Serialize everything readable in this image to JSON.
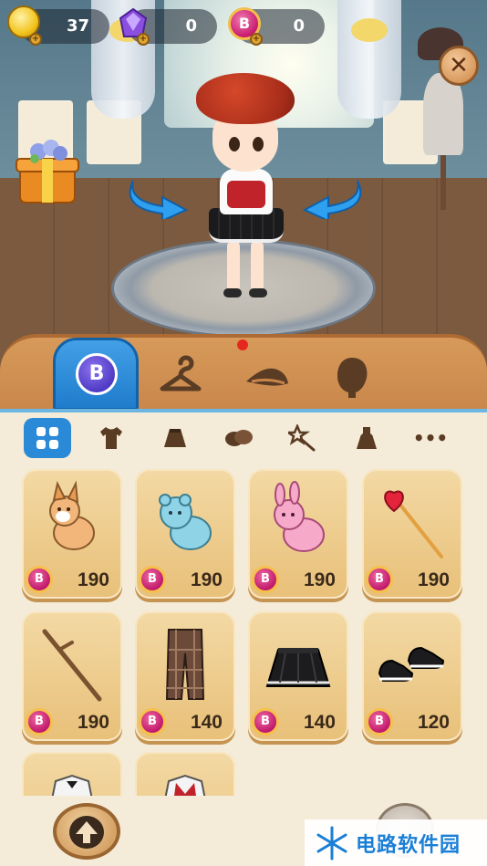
{
  "currencies": {
    "coins": {
      "value": "37",
      "icon": "gold-coin-icon"
    },
    "gems": {
      "value": "0",
      "icon": "purple-gem-icon"
    },
    "b_coins": {
      "value": "0",
      "icon": "b-coin-icon"
    }
  },
  "b_symbol": "B",
  "close_glyph": "✕",
  "tabs": [
    {
      "name": "b-shop-tab",
      "icon": "b-badge-icon",
      "active": true
    },
    {
      "name": "clothes-tab",
      "icon": "hanger-icon",
      "active": false
    },
    {
      "name": "hat-tab",
      "icon": "hat-icon",
      "active": false,
      "notification": true
    },
    {
      "name": "hair-tab",
      "icon": "head-silhouette-icon",
      "active": false
    }
  ],
  "subtabs": [
    {
      "name": "all",
      "icon": "grid-icon",
      "active": true
    },
    {
      "name": "tops",
      "icon": "tshirt-icon"
    },
    {
      "name": "bottoms",
      "icon": "skirt-icon"
    },
    {
      "name": "shoes",
      "icon": "shoes-icon"
    },
    {
      "name": "accessories",
      "icon": "wand-icon"
    },
    {
      "name": "dresses",
      "icon": "dress-icon"
    },
    {
      "name": "more",
      "icon": "more-dots-icon",
      "glyph": "•••"
    }
  ],
  "items": [
    {
      "name": "fox-plush",
      "price": "190"
    },
    {
      "name": "blue-bear-plush",
      "price": "190"
    },
    {
      "name": "pink-bunny-plush",
      "price": "190"
    },
    {
      "name": "heart-wand",
      "price": "190"
    },
    {
      "name": "wooden-stick",
      "price": "190"
    },
    {
      "name": "plaid-pants",
      "price": "140"
    },
    {
      "name": "black-pleated-skirt",
      "price": "140"
    },
    {
      "name": "black-sneakers",
      "price": "120"
    }
  ],
  "watermark": {
    "text": "电路软件园",
    "icon": "snowflake-logo-icon"
  },
  "colors": {
    "accent_blue": "#2a8ad8",
    "card": "#efcf94",
    "tab_bar": "#d08f52",
    "b_coin": "#d82679"
  }
}
